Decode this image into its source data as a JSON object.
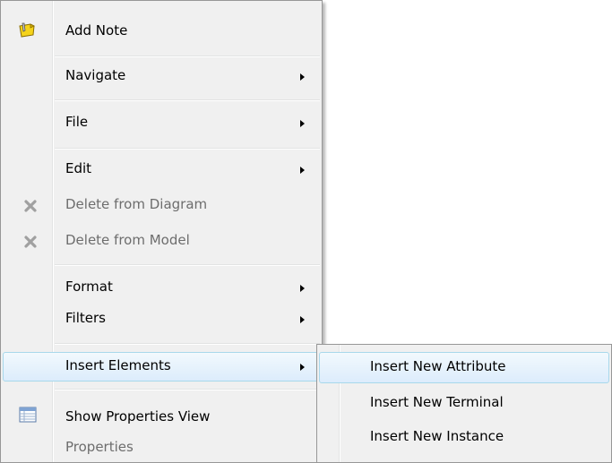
{
  "main_menu": {
    "add_note": "Add Note",
    "navigate": "Navigate",
    "file": "File",
    "edit": "Edit",
    "delete_from_diagram": "Delete from Diagram",
    "delete_from_model": "Delete from Model",
    "format": "Format",
    "filters": "Filters",
    "insert_elements": "Insert Elements",
    "show_properties_view": "Show Properties View",
    "properties": "Properties"
  },
  "sub_menu": {
    "insert_new_attribute": "Insert New Attribute",
    "insert_new_terminal": "Insert New Terminal",
    "insert_new_instance": "Insert New Instance"
  },
  "icons": {
    "add_note": "sticky-note-icon",
    "delete": "delete-x-icon",
    "properties": "properties-table-icon"
  },
  "colors": {
    "menu_bg": "#f0f0f0",
    "highlight_border": "#a8d8eb",
    "disabled_text": "#6d6d6d"
  }
}
